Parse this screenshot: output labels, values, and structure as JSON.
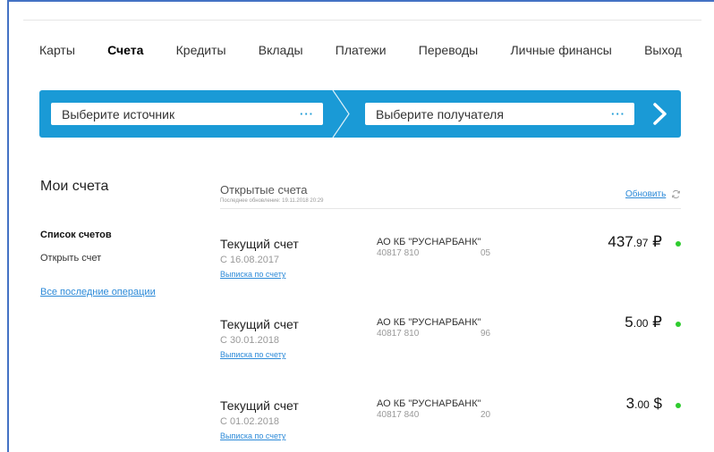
{
  "nav": {
    "items": [
      "Карты",
      "Счета",
      "Кредиты",
      "Вклады",
      "Платежи",
      "Переводы",
      "Личные финансы",
      "Выход"
    ]
  },
  "transfer": {
    "source_placeholder": "Выберите источник",
    "target_placeholder": "Выберите получателя",
    "dots": "···",
    "accent_color": "#1a9ad6"
  },
  "sidebar": {
    "title": "Мои счета",
    "accounts_list": "Список счетов",
    "open_account": "Открыть счет",
    "recent_operations": "Все последние операции"
  },
  "main": {
    "title": "Открытые счета",
    "last_update": "Последнее обновление: 19.11.2018 20:29",
    "refresh_label": "Обновить",
    "accounts": [
      {
        "name": "Текущий счет",
        "date": "С 16.08.2017",
        "statement": "Выписка по счету",
        "bank": "АО КБ \"РУСНАРБАНК\"",
        "num_start": "40817 810",
        "num_end": "05",
        "amount_int": "437",
        "amount_frac": ".97",
        "currency": "₽"
      },
      {
        "name": "Текущий счет",
        "date": "С 30.01.2018",
        "statement": "Выписка по счету",
        "bank": "АО КБ \"РУСНАРБАНК\"",
        "num_start": "40817 810",
        "num_end": "96",
        "amount_int": "5",
        "amount_frac": ".00",
        "currency": "₽"
      },
      {
        "name": "Текущий счет",
        "date": "С 01.02.2018",
        "statement": "Выписка по счету",
        "bank": "АО КБ \"РУСНАРБАНК\"",
        "num_start": "40817 840",
        "num_end": "20",
        "amount_int": "3",
        "amount_frac": ".00",
        "currency": "$"
      }
    ],
    "status_color": "#2ecc2e"
  }
}
